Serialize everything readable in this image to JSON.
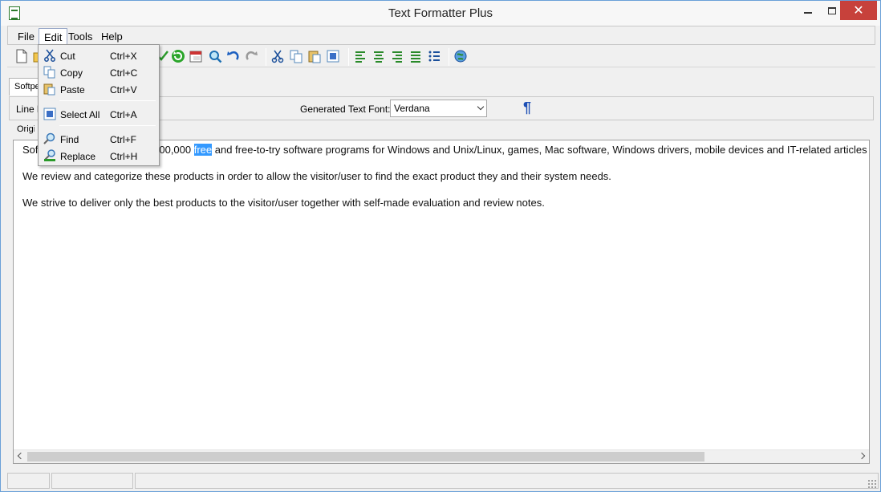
{
  "window": {
    "title": "Text Formatter Plus",
    "close_glyph": "✕"
  },
  "menubar": {
    "items": [
      "File",
      "Edit",
      "Tools",
      "Help"
    ]
  },
  "edit_menu": {
    "items": [
      {
        "label": "Cut",
        "shortcut": "Ctrl+X",
        "icon": "scissors-icon"
      },
      {
        "label": "Copy",
        "shortcut": "Ctrl+C",
        "icon": "copy-icon"
      },
      {
        "label": "Paste",
        "shortcut": "Ctrl+V",
        "icon": "paste-icon"
      },
      {
        "label": "Select All",
        "shortcut": "Ctrl+A",
        "icon": "select-all-icon"
      },
      {
        "label": "Find",
        "shortcut": "Ctrl+F",
        "icon": "find-icon"
      },
      {
        "label": "Replace",
        "shortcut": "Ctrl+H",
        "icon": "replace-icon"
      }
    ]
  },
  "tabs": {
    "active_label": "Softpe"
  },
  "options": {
    "line_label": "Line l",
    "font_label": "Generated Text Font:",
    "font_value": "Verdana",
    "pilcrow": "¶",
    "original_label": "Origin"
  },
  "text": {
    "line1_before": "Sof",
    "line1_mid": ",300,000 ",
    "line1_highlight": "free",
    "line1_after": " and free-to-try software programs for Windows and Unix/Linux, games, Mac software, Windows drivers, mobile devices and IT-related articles",
    "line2": "We review and categorize these products in order to allow the visitor/user to find the exact product they and their system needs.",
    "line3": "We strive to deliver only the best products to the visitor/user together with self-made evaluation and review notes."
  },
  "colors": {
    "highlight": "#3399ff",
    "close_button": "#c7413b",
    "pilcrow": "#1d4fb5"
  }
}
